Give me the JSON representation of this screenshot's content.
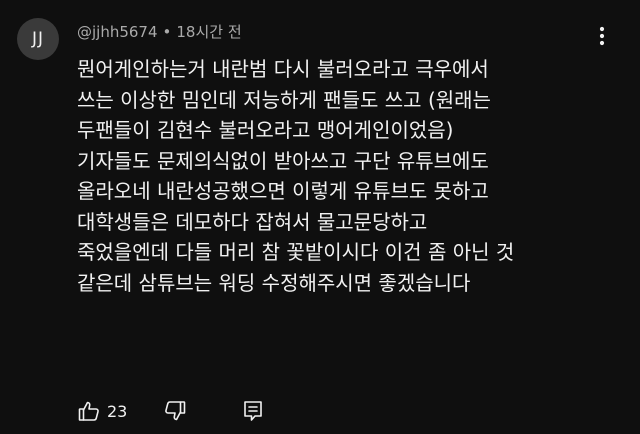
{
  "comment": {
    "avatar_initials": "JJ",
    "author": "@jjhh5674",
    "separator": "•",
    "timestamp": "18시간 전",
    "lines": [
      "뭔어게인하는거 내란범 다시 불러오라고 극우에서",
      "쓰는 이상한 밈인데 저능하게 팬들도 쓰고 (원래는",
      "두팬들이 김현수 불러오라고 맹어게인이었음)",
      "기자들도 문제의식없이 받아쓰고 구단 유튜브에도",
      "올라오네 내란성공했으면 이렇게 유튜브도 못하고",
      "대학생들은 데모하다 잡혀서 물고문당하고",
      "죽었을엔데 다들 머리 참 꽃밭이시다 이건 좀 아닌 것",
      "같은데 삼튜브는 워딩 수정해주시면 좋겠습니다"
    ],
    "like_count": "23",
    "icons": {
      "more": "more-vert-icon",
      "like": "thumb-up-icon",
      "dislike": "thumb-down-icon",
      "reply": "reply-comment-icon"
    },
    "colors": {
      "background": "#0f0f0f",
      "text": "#f1f1f1",
      "muted": "#aaaaaa",
      "avatar_bg": "#3a3a3a"
    }
  }
}
